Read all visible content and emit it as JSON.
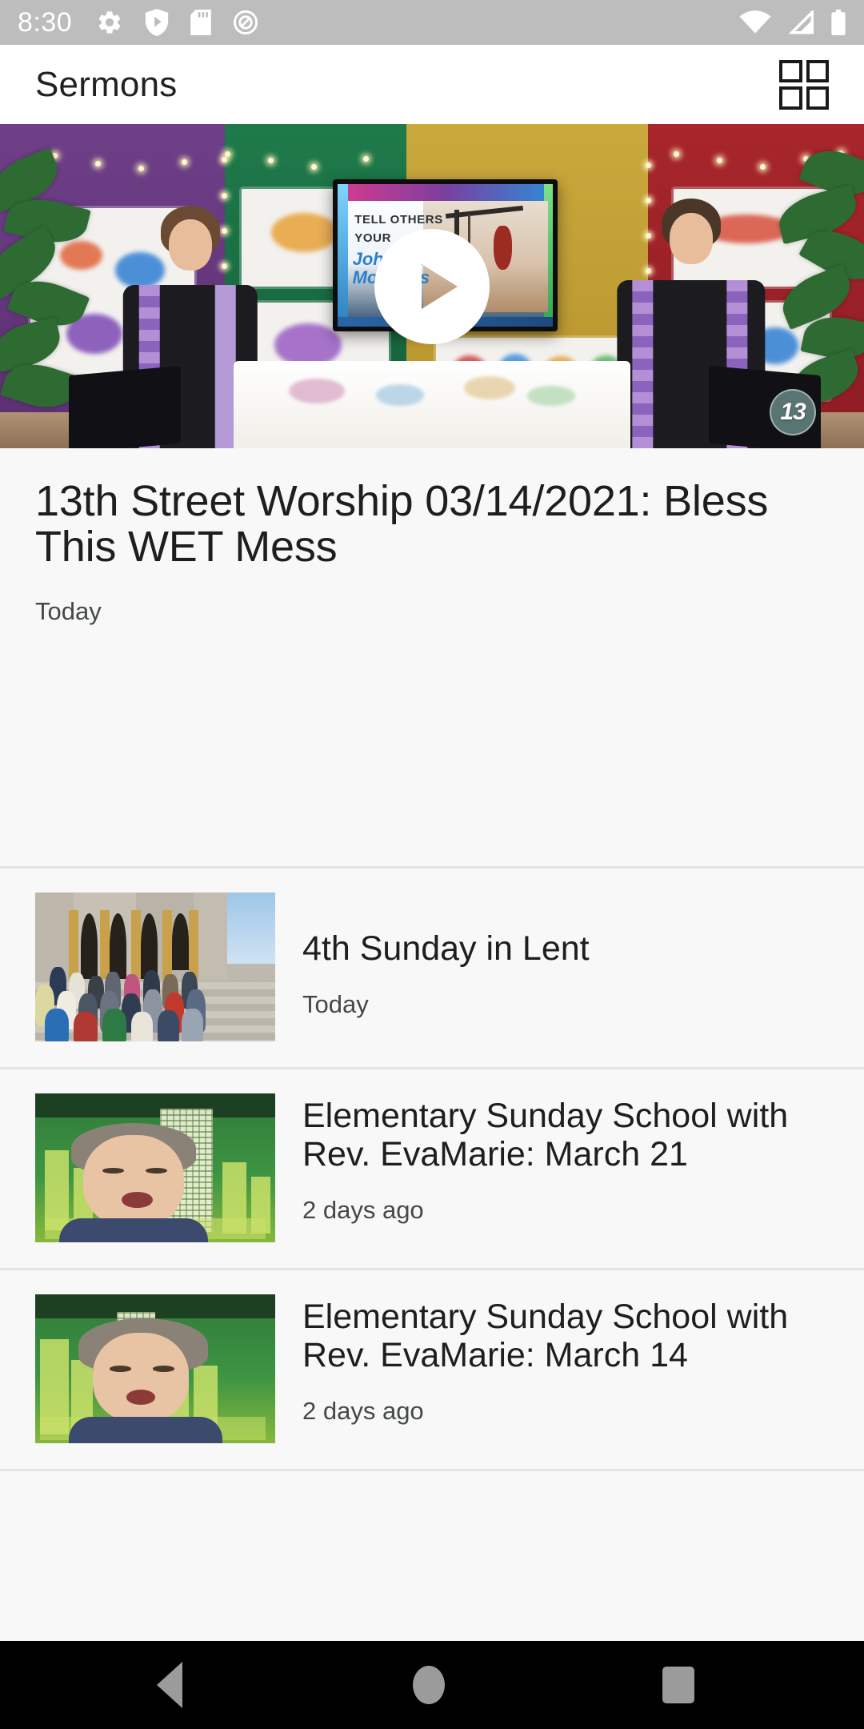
{
  "statusbar": {
    "time": "8:30",
    "icons": [
      "gear-icon",
      "play-shield-icon",
      "sd-card-icon",
      "circle-q-icon"
    ],
    "right_icons": [
      "wifi-icon",
      "cell-signal-icon",
      "battery-icon"
    ]
  },
  "appbar": {
    "title": "Sermons",
    "grid_view_label": "Grid view"
  },
  "hero": {
    "play_label": "Play",
    "title": "13th Street Worship 03/14/2021: Bless This WET Mess",
    "subtitle": "Today",
    "watermark": "13",
    "thumbnail_alt": "Two ministers in purple stoles seated beside a table in a colorful studio set",
    "screen_text": {
      "line1": "TELL OTHERS",
      "line2": "YOUR",
      "line3": "Johannine",
      "line4": "Moments"
    }
  },
  "list": {
    "items": [
      {
        "title": "4th Sunday in Lent",
        "subtitle": "Today",
        "thumbnail_alt": "Congregation posed on the stone steps of a church"
      },
      {
        "title": "Elementary Sunday School with Rev. EvaMarie: March 21",
        "subtitle": "2 days ago",
        "thumbnail_alt": "Woman speaking in front of a green city skyline background"
      },
      {
        "title": "Elementary Sunday School with Rev. EvaMarie: March 14",
        "subtitle": "2 days ago",
        "thumbnail_alt": "Woman speaking in front of a green city skyline background"
      }
    ]
  },
  "navbar": {
    "back": "Back",
    "home": "Home",
    "recents": "Recent apps"
  },
  "colors": {
    "statusbar_bg": "#bdbdbd",
    "appbar_bg": "#ffffff",
    "page_bg": "#f8f8f8",
    "text_primary": "#1c1f1d",
    "text_secondary": "#44484a",
    "divider": "#e3e4e5",
    "navbar_bg": "#000000",
    "navbar_icon": "#9b9b9b"
  }
}
